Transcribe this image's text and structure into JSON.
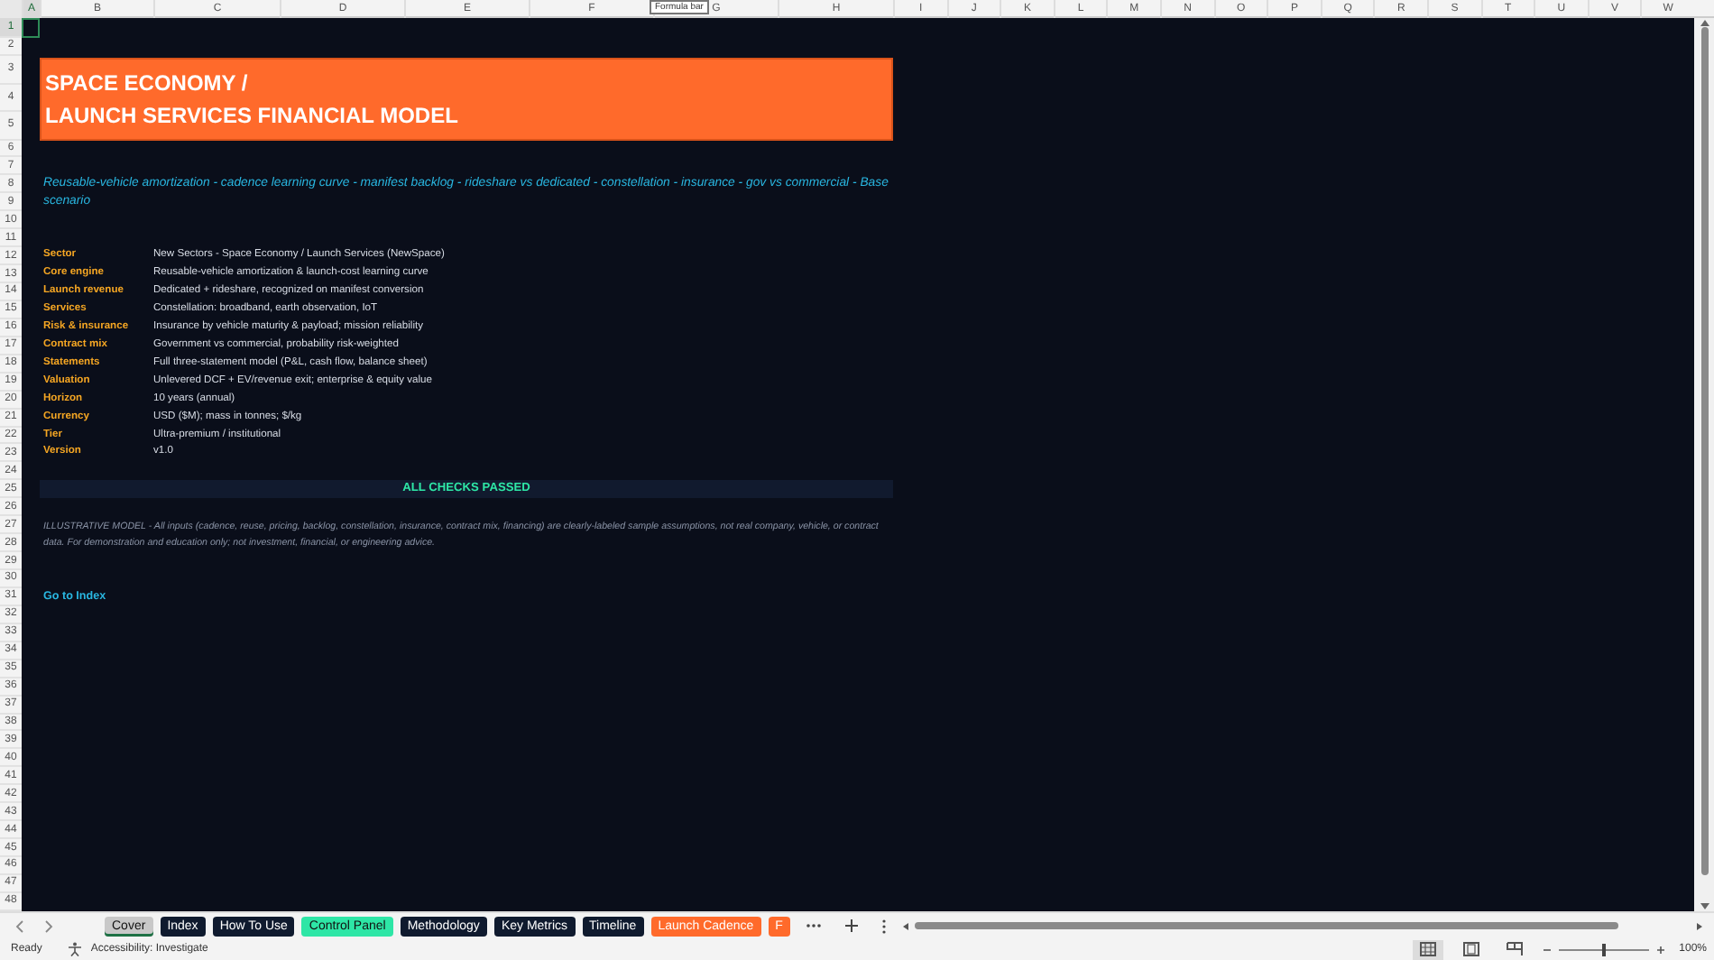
{
  "formula_bar_tooltip": "Formula bar",
  "column_headers": [
    {
      "label": "A",
      "selected": true
    },
    {
      "label": "B",
      "selected": false
    },
    {
      "label": "C",
      "selected": false
    },
    {
      "label": "D",
      "selected": false
    },
    {
      "label": "E",
      "selected": false
    },
    {
      "label": "F",
      "selected": false
    },
    {
      "label": "G",
      "selected": false
    },
    {
      "label": "H",
      "selected": false
    },
    {
      "label": "I",
      "selected": false
    },
    {
      "label": "J",
      "selected": false
    },
    {
      "label": "K",
      "selected": false
    },
    {
      "label": "L",
      "selected": false
    },
    {
      "label": "M",
      "selected": false
    },
    {
      "label": "N",
      "selected": false
    },
    {
      "label": "O",
      "selected": false
    },
    {
      "label": "P",
      "selected": false
    },
    {
      "label": "Q",
      "selected": false
    },
    {
      "label": "R",
      "selected": false
    },
    {
      "label": "S",
      "selected": false
    },
    {
      "label": "T",
      "selected": false
    },
    {
      "label": "U",
      "selected": false
    },
    {
      "label": "V",
      "selected": false
    },
    {
      "label": "W",
      "selected": false
    }
  ],
  "row_numbers": [
    {
      "label": "1",
      "selected": true
    },
    {
      "label": "2",
      "selected": false
    },
    {
      "label": "3",
      "selected": false
    },
    {
      "label": "4",
      "selected": false
    },
    {
      "label": "5",
      "selected": false
    },
    {
      "label": "6",
      "selected": false
    },
    {
      "label": "7",
      "selected": false
    },
    {
      "label": "8",
      "selected": false
    },
    {
      "label": "9",
      "selected": false
    },
    {
      "label": "10",
      "selected": false
    },
    {
      "label": "11",
      "selected": false
    },
    {
      "label": "12",
      "selected": false
    },
    {
      "label": "13",
      "selected": false
    },
    {
      "label": "14",
      "selected": false
    },
    {
      "label": "15",
      "selected": false
    },
    {
      "label": "16",
      "selected": false
    },
    {
      "label": "17",
      "selected": false
    },
    {
      "label": "18",
      "selected": false
    },
    {
      "label": "19",
      "selected": false
    },
    {
      "label": "20",
      "selected": false
    },
    {
      "label": "21",
      "selected": false
    },
    {
      "label": "22",
      "selected": false
    },
    {
      "label": "23",
      "selected": false
    },
    {
      "label": "24",
      "selected": false
    },
    {
      "label": "25",
      "selected": false
    },
    {
      "label": "26",
      "selected": false
    },
    {
      "label": "27",
      "selected": false
    },
    {
      "label": "28",
      "selected": false
    },
    {
      "label": "29",
      "selected": false
    },
    {
      "label": "30",
      "selected": false
    },
    {
      "label": "31",
      "selected": false
    },
    {
      "label": "32",
      "selected": false
    },
    {
      "label": "33",
      "selected": false
    },
    {
      "label": "34",
      "selected": false
    },
    {
      "label": "35",
      "selected": false
    },
    {
      "label": "36",
      "selected": false
    },
    {
      "label": "37",
      "selected": false
    },
    {
      "label": "38",
      "selected": false
    },
    {
      "label": "39",
      "selected": false
    },
    {
      "label": "40",
      "selected": false
    },
    {
      "label": "41",
      "selected": false
    },
    {
      "label": "42",
      "selected": false
    },
    {
      "label": "43",
      "selected": false
    },
    {
      "label": "44",
      "selected": false
    },
    {
      "label": "45",
      "selected": false
    },
    {
      "label": "46",
      "selected": false
    },
    {
      "label": "47",
      "selected": false
    },
    {
      "label": "48",
      "selected": false
    }
  ],
  "sheet": {
    "title_lines": [
      "SPACE ECONOMY /",
      "LAUNCH SERVICES FINANCIAL MODEL"
    ],
    "subtitle": "Reusable-vehicle amortization - cadence learning curve - manifest backlog - rideshare vs dedicated - constellation - insurance - gov vs commercial - Base scenario",
    "facts": [
      {
        "label": "Sector",
        "value": "New Sectors - Space Economy / Launch Services (NewSpace)"
      },
      {
        "label": "Core engine",
        "value": "Reusable-vehicle amortization & launch-cost learning curve"
      },
      {
        "label": "Launch revenue",
        "value": "Dedicated + rideshare, recognized on manifest conversion"
      },
      {
        "label": "Services",
        "value": "Constellation: broadband, earth observation, IoT"
      },
      {
        "label": "Risk & insurance",
        "value": "Insurance by vehicle maturity & payload; mission reliability"
      },
      {
        "label": "Contract mix",
        "value": "Government vs commercial, probability risk-weighted"
      },
      {
        "label": "Statements",
        "value": "Full three-statement model (P&L, cash flow, balance sheet)"
      },
      {
        "label": "Valuation",
        "value": "Unlevered DCF + EV/revenue exit; enterprise & equity value"
      },
      {
        "label": "Horizon",
        "value": "10 years (annual)"
      },
      {
        "label": "Currency",
        "value": "USD ($M); mass in tonnes; $/kg"
      },
      {
        "label": "Tier",
        "value": "Ultra-premium / institutional"
      },
      {
        "label": "Version",
        "value": "v1.0"
      }
    ],
    "check_status": "ALL CHECKS PASSED",
    "disclaimer": "ILLUSTRATIVE MODEL - All inputs (cadence, reuse, pricing, backlog, constellation, insurance, contract mix, financing) are clearly-labeled sample assumptions, not real company, vehicle, or contract data. For demonstration and education only; not investment, financial, or engineering advice.",
    "link": "Go to Index"
  },
  "sheet_tabs": [
    {
      "label": "Cover",
      "color": "#c8c8c8",
      "selected": true
    },
    {
      "label": "Index",
      "color": "#0f1a2e",
      "selected": false
    },
    {
      "label": "How To Use",
      "color": "#0f1a2e",
      "selected": false
    },
    {
      "label": "Control Panel",
      "color": "#2ee6a6",
      "selected": false
    },
    {
      "label": "Methodology",
      "color": "#0f1a2e",
      "selected": false
    },
    {
      "label": "Key Metrics",
      "color": "#0f1a2e",
      "selected": false
    },
    {
      "label": "Timeline",
      "color": "#0f1a2e",
      "selected": false
    },
    {
      "label": "Launch Cadence",
      "color": "#ff6a2b",
      "selected": false
    },
    {
      "label": "F",
      "color": "#ff6a2b",
      "selected": false
    }
  ],
  "status_bar": {
    "mode": "Ready",
    "accessibility": "Accessibility: Investigate",
    "views": [
      {
        "kind": "normal",
        "selected": true
      },
      {
        "kind": "page_layout",
        "selected": false
      },
      {
        "kind": "page_break",
        "selected": false
      }
    ],
    "zoom": {
      "level": 0.5,
      "reading": "100%"
    }
  }
}
